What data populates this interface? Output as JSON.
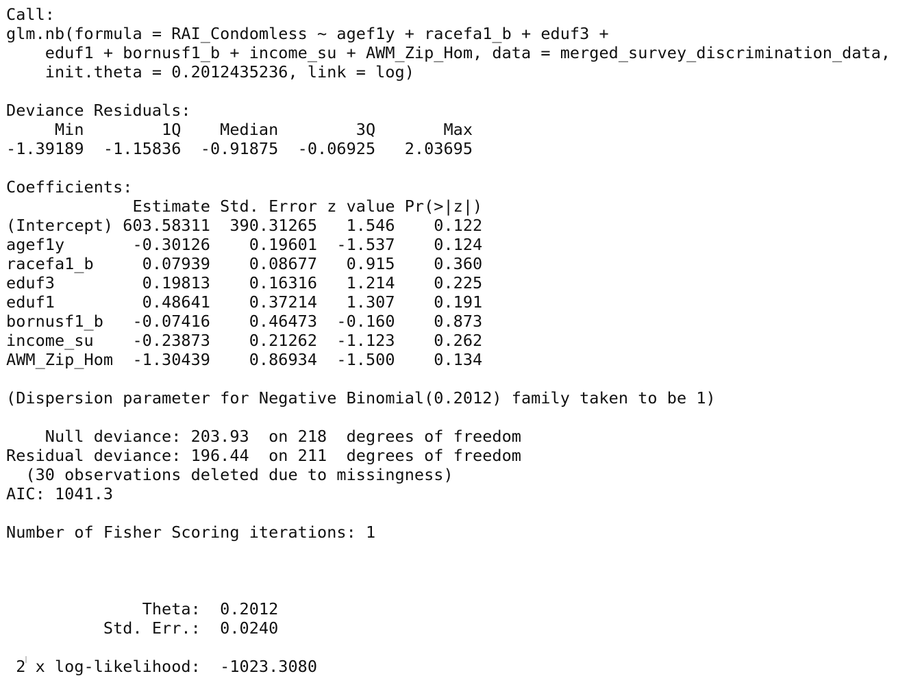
{
  "console": {
    "call": {
      "header": "Call:",
      "lines": [
        "glm.nb(formula = RAI_Condomless ~ agef1y + racefa1_b + eduf3 + ",
        "    eduf1 + bornusf1_b + income_su + AWM_Zip_Hom, data = merged_survey_discrimination_data, ",
        "    init.theta = 0.2012435236, link = log)"
      ]
    },
    "deviance_residuals": {
      "header": "Deviance Residuals: ",
      "labels_line": "     Min        1Q    Median        3Q       Max  ",
      "values_line": "-1.39189  -1.15836  -0.91875  -0.06925   2.03695  "
    },
    "coefficients": {
      "header": "Coefficients:",
      "columns_line": "             Estimate Std. Error z value Pr(>|z|)",
      "rows": [
        "(Intercept) 603.58311  390.31265   1.546    0.122",
        "agef1y       -0.30126    0.19601  -1.537    0.124",
        "racefa1_b     0.07939    0.08677   0.915    0.360",
        "eduf3         0.19813    0.16316   1.214    0.225",
        "eduf1         0.48641    0.37214   1.307    0.191",
        "bornusf1_b   -0.07416    0.46473  -0.160    0.873",
        "income_su    -0.23873    0.21262  -1.123    0.262",
        "AWM_Zip_Hom  -1.30439    0.86934  -1.500    0.134"
      ]
    },
    "dispersion_note": "(Dispersion parameter for Negative Binomial(0.2012) family taken to be 1)",
    "fit": {
      "null_deviance": "    Null deviance: 203.93  on 218  degrees of freedom",
      "residual_deviance": "Residual deviance: 196.44  on 211  degrees of freedom",
      "missing_note": "  (30 observations deleted due to missingness)",
      "aic": "AIC: 1041.3"
    },
    "fisher_iterations": "Number of Fisher Scoring iterations: 1",
    "theta": {
      "theta_line": "              Theta:  0.2012 ",
      "std_err_line": "          Std. Err.:  0.0240 "
    },
    "loglik_line": " 2 x log-likelihood:  -1023.3080 "
  }
}
